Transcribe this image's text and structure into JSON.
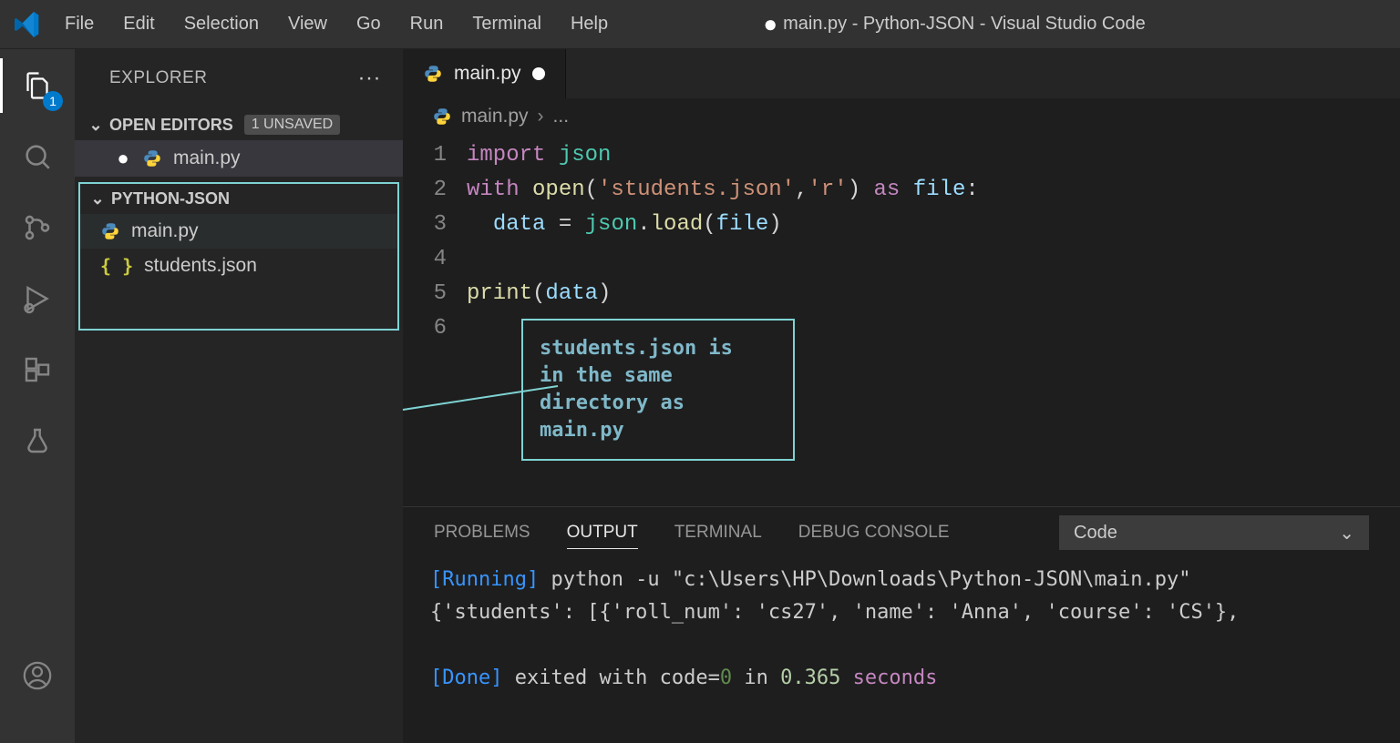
{
  "titlebar": {
    "menus": {
      "file": "File",
      "edit": "Edit",
      "selection": "Selection",
      "view": "View",
      "go": "Go",
      "run": "Run",
      "terminal": "Terminal",
      "help": "Help"
    },
    "window_title": "main.py - Python-JSON - Visual Studio Code"
  },
  "activity": {
    "badge": "1"
  },
  "sidebar": {
    "explorer_label": "EXPLORER",
    "open_editors_label": "OPEN EDITORS",
    "unsaved_badge": "1 UNSAVED",
    "open_editors": [
      {
        "name": "main.py",
        "dirty": true
      }
    ],
    "project_name": "PYTHON-JSON",
    "files": [
      {
        "name": "main.py",
        "kind": "python"
      },
      {
        "name": "students.json",
        "kind": "json"
      }
    ]
  },
  "tab": {
    "name": "main.py",
    "dirty": true
  },
  "breadcrumb": {
    "file": "main.py",
    "rest": "..."
  },
  "code": {
    "line_numbers": [
      "1",
      "2",
      "3",
      "4",
      "5",
      "6"
    ],
    "l1": {
      "kw": "import",
      "mod": "json"
    },
    "l2": {
      "kw_with": "with",
      "fn_open": "open",
      "arg1": "'students.json'",
      "arg2": "'r'",
      "kw_as": "as",
      "var": "file"
    },
    "l3": {
      "var_data": "data",
      "mod": "json",
      "fn_load": "load",
      "arg": "file"
    },
    "l5": {
      "fn": "print",
      "arg": "data"
    }
  },
  "annotation": "students.json is\nin the same\ndirectory as\nmain.py",
  "panel": {
    "tabs": {
      "problems": "PROBLEMS",
      "output": "OUTPUT",
      "terminal": "TERMINAL",
      "debug": "DEBUG CONSOLE"
    },
    "select": "Code",
    "out_running": "[Running]",
    "out_cmd": " python -u \"c:\\Users\\HP\\Downloads\\Python-JSON\\main.py\"",
    "out_result": "{'students': [{'roll_num': 'cs27', 'name': 'Anna', 'course': 'CS'},",
    "out_done": "[Done]",
    "out_exit": " exited with code=",
    "out_zero": "0",
    "out_in": " in ",
    "out_time": "0.365",
    "out_sec": " seconds"
  }
}
